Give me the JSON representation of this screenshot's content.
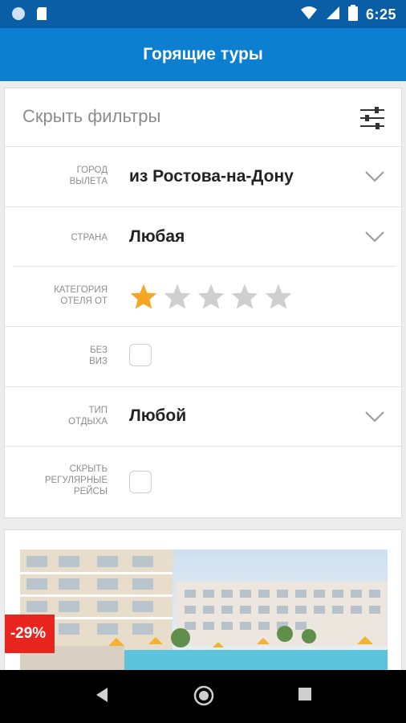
{
  "status_bar": {
    "time": "6:25"
  },
  "header": {
    "title": "Горящие туры"
  },
  "filters": {
    "hide_filters_label": "Скрыть фильтры",
    "departure_city": {
      "label": [
        "Город",
        "вылета"
      ],
      "value": "из Ростова-на-Дону"
    },
    "country": {
      "label": [
        "Страна"
      ],
      "value": "Любая"
    },
    "hotel_category": {
      "label": [
        "Категория",
        "отеля от"
      ],
      "stars_selected": 1,
      "stars_total": 5
    },
    "no_visa": {
      "label": [
        "Без",
        "виз"
      ],
      "checked": false
    },
    "vacation_type": {
      "label": [
        "Тип",
        "отдыха"
      ],
      "value": "Любой"
    },
    "hide_regular_flights": {
      "label": [
        "Скрыть",
        "регулярные",
        "рейсы"
      ],
      "checked": false
    }
  },
  "promo": {
    "discount": "-29%"
  },
  "colors": {
    "status_bar": "#0a5ea6",
    "app_bar": "#0c7fd1",
    "star_active": "#f5a623",
    "star_inactive": "#cfcfcf",
    "discount_badge": "#e8241f"
  }
}
